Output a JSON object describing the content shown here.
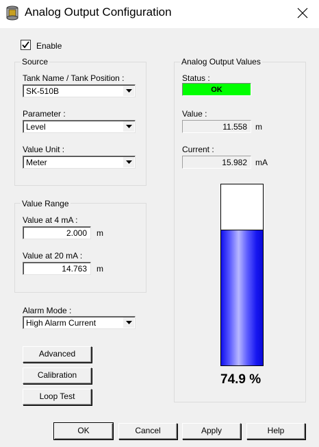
{
  "window": {
    "title": "Analog Output Configuration",
    "icon": "tank-icon",
    "close": "close-icon"
  },
  "enable": {
    "label": "Enable",
    "checked": true
  },
  "source": {
    "title": "Source",
    "tank_label": "Tank Name / Tank Position :",
    "tank_value": "SK-510B",
    "parameter_label": "Parameter :",
    "parameter_value": "Level",
    "unit_label": "Value Unit :",
    "unit_value": "Meter"
  },
  "value_range": {
    "title": "Value Range",
    "at4_label": "Value at 4 mA :",
    "at4_value": "2.000",
    "at4_unit": "m",
    "at20_label": "Value at 20 mA :",
    "at20_value": "14.763",
    "at20_unit": "m"
  },
  "alarm": {
    "label": "Alarm Mode :",
    "value": "High Alarm Current"
  },
  "side_buttons": {
    "advanced": "Advanced",
    "calibration": "Calibration",
    "loop_test": "Loop Test"
  },
  "output": {
    "title": "Analog Output Values",
    "status_label": "Status :",
    "status_value": "OK",
    "status_color": "#00ff00",
    "value_label": "Value :",
    "value": "11.558",
    "value_unit": "m",
    "current_label": "Current :",
    "current": "15.982",
    "current_unit": "mA",
    "level_fraction": 0.749,
    "level_text": "74.9 %",
    "bar_color": "#1a1aff"
  },
  "footer": {
    "ok": "OK",
    "cancel": "Cancel",
    "apply": "Apply",
    "help": "Help"
  }
}
